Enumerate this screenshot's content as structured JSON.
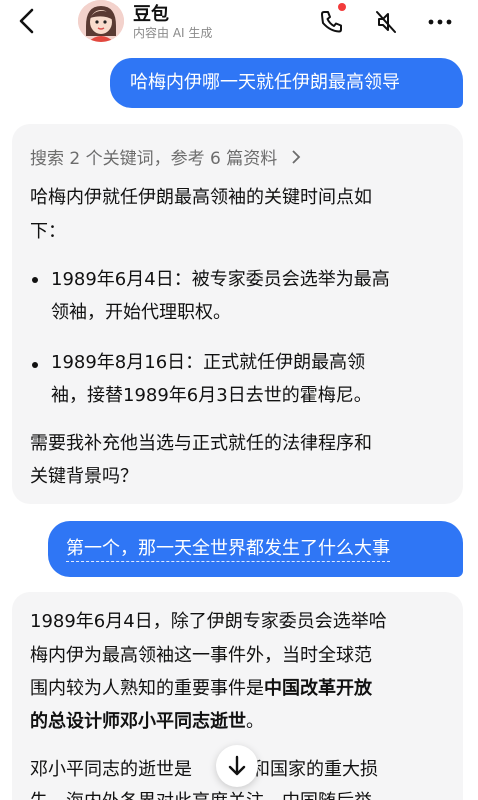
{
  "header": {
    "title": "豆包",
    "subtitle": "内容由 AI 生成",
    "icons": [
      "back-arrow-icon",
      "avatar",
      "phone-call-icon",
      "mute-icon",
      "more-icon"
    ],
    "notification_color": "#f23b3b"
  },
  "messages": {
    "user_1": "哈梅内伊哪一天就任伊朗最高领导",
    "search_summary": "搜索 2 个关键词，参考 6 篇资料",
    "ai_1": {
      "intro_line1": "哈梅内伊就任伊朗最高领袖的关键时间点如",
      "intro_line2": "下：",
      "bullet1_line1": "1989年6月4日：被专家委员会选举为最高",
      "bullet1_line2": "领袖，开始代理职权。",
      "bullet2_line1": "1989年8月16日：正式就任伊朗最高领",
      "bullet2_line2": "袖，接替1989年6月3日去世的霍梅尼。",
      "followup_line1": "需要我补充他当选与正式就任的法律程序和",
      "followup_line2": "关键背景吗？"
    },
    "user_2": "第一个，那一天全世界都发生了什么大事",
    "ai_2": {
      "line1": "1989年6月4日，除了伊朗专家委员会选举哈",
      "line2": "梅内伊为最高领袖这一事件外，当时全球范",
      "line3_plain": "围内较为人熟知的重要事件是",
      "line3_bold": "中国改革开放",
      "line4_bold": "的总设计师邓小平同志逝世",
      "line4_plain": "。",
      "line5_a": "邓小平同志的逝世是",
      "line5_b": "党和国家的重大损",
      "line6": "失，海内外各界对此高度关注，中国随后举"
    }
  },
  "colors": {
    "user_bubble": "#2f76f5",
    "ai_bubble": "#f5f5f6"
  }
}
